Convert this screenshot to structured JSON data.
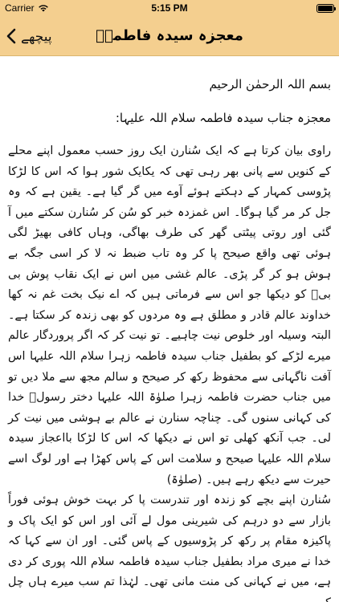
{
  "status_bar": {
    "carrier": "Carrier",
    "time": "5:15 PM",
    "battery_level": 1.0
  },
  "nav": {
    "title": "معجزہ سیدہ فاطمہؑ",
    "back_label": "پیچھے"
  },
  "content": {
    "bismillah": "بسم اللہ الرحمٰن الرحیم",
    "heading": "معجزہ جناب سیدہ فاطمہ سلام اللہ علیہا:",
    "body": "راوی بیان کرتا ہے کہ ایک سُنارن ایک روز حسب معمول اپنے محلے کے کنویں سے پانی بھر رہی تھی کہ یکایک شور ہوا کہ اس کا لڑکا پڑوسی کمہار کے دہکتے ہوئے آوے میں گر گیا ہے۔ یقین ہے کہ وہ جل کر مر گیا ہوگا۔ اس غمزدہ خبر کو سُن کر سُنارن سکتے میں آ گئی اور روتی پیٹتی گھر کی طرف بھاگی، وہاں کافی بھیڑ لگی ہوئی تھی واقع صیحح پا کر وہ تاب ضبط نہ لا کر اسی جگہ بے ہوش ہو کر گر پڑی۔ عالم غشی میں اس نے ایک نقاب پوش بی بیؑ کو دیکھا جو اس سے فرماتی ہیں کہ اے نیک بخت غم نہ کھا خداوند عالم قادر و مطلق ہے وہ مردوں کو بھی زندہ کر سکتا ہے۔ البتہ وسیلہ اور خلوص نیت چاہیے۔ تو نیت کر کہ اگر پروردگار عالم میرے لڑکے کو بطفیل جناب سیدہ فاطمہ زہرا سلام اللہ علیہا اس آفت ناگہانی سے محفوظ رکھ کر صیحح و سالم مجھ سے ملا دیں تو میں جناب حضرت فاطمہ زہرا صلوٰۃ اللہ علیہا دختر رسولؐ خدا کی کہانی سنوں گی۔ چناچہ سنارن نے عالم بے ہوشی میں نیت کر لی۔ جب آنکھ کھلی تو اس نے دیکھا کہ اس کا لڑکا بااعجاز سیدہ سلام اللہ علیہا صیحح و سلامت اس کے پاس کھڑا ہے اور لوگ اسے حیرت سے دیکھ رہے ہیں۔ (صلوٰۃ)\nسُنارن اپنے بچے کو زندہ اور تندرست پا کر بہت خوش ہوئی فوراً بازار سے دو درہم کی شیرینی مول لے آئی اور اس کو ایک پاک و پاکیزہ مقام پر رکھ کر پڑوسیوں کے پاس گئی۔ اور ان سے کہا کہ خدا نے میری مراد بطفیل جناب سیدہ فاطمہ سلام اللہ پوری کر دی ہے، میں نے کہانی کی منت مانی تھی۔ لہٰذا تم سب میرے ہاں چل کر"
  }
}
